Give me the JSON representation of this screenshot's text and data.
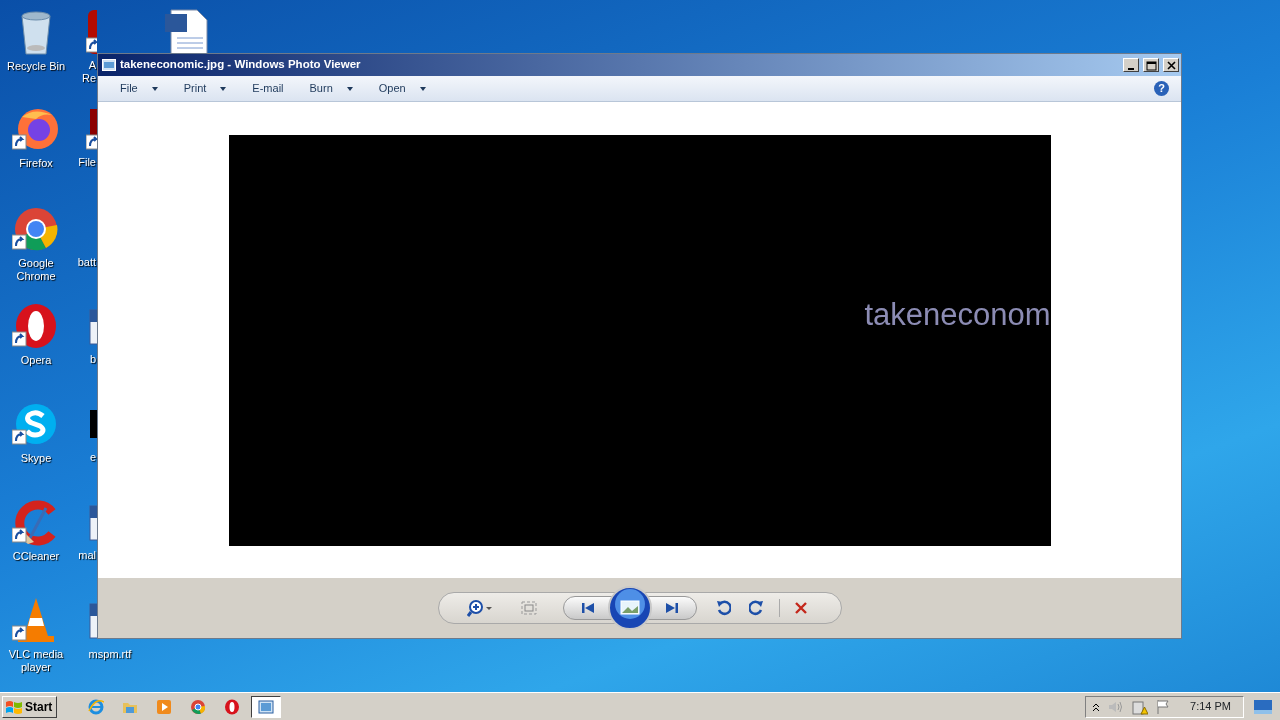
{
  "desktop_icons": [
    {
      "lines": [
        "Recycle Bin"
      ],
      "kind": "full",
      "shortcut": false
    },
    {
      "lines": [
        "Firefox"
      ],
      "kind": "full",
      "shortcut": true
    },
    {
      "lines": [
        "Google",
        "Chrome"
      ],
      "kind": "full",
      "shortcut": true
    },
    {
      "lines": [
        "Opera"
      ],
      "kind": "full",
      "shortcut": true
    },
    {
      "lines": [
        "Skype"
      ],
      "kind": "full",
      "shortcut": true
    },
    {
      "lines": [
        "CCleaner"
      ],
      "kind": "full",
      "shortcut": true
    },
    {
      "lines": [
        "VLC media",
        "player"
      ],
      "kind": "full",
      "shortcut": true
    },
    {
      "lines": [
        "A",
        "Re"
      ],
      "kind": "cut",
      "shortcut": true
    },
    {
      "lines": [
        "File"
      ],
      "kind": "cut",
      "shortcut": true
    },
    {
      "lines": [
        "batt"
      ],
      "kind": "cut",
      "shortcut": false
    },
    {
      "lines": [
        "b"
      ],
      "kind": "cut",
      "shortcut": false
    },
    {
      "lines": [
        "e"
      ],
      "kind": "cut",
      "shortcut": false
    },
    {
      "lines": [
        "mal"
      ],
      "kind": "cut",
      "shortcut": false
    },
    {
      "lines": [
        "mspm.rtf"
      ],
      "kind": "full",
      "shortcut": false
    }
  ],
  "window": {
    "title": "takeneconomic.jpg - Windows Photo Viewer",
    "menu": [
      {
        "label": "File",
        "dropdown": true
      },
      {
        "label": "Print",
        "dropdown": true
      },
      {
        "label": "E-mail",
        "dropdown": false
      },
      {
        "label": "Burn",
        "dropdown": true
      },
      {
        "label": "Open",
        "dropdown": true
      }
    ],
    "help": "?",
    "image_text": "takeneconom"
  },
  "taskbar": {
    "start": "Start",
    "apps": [
      {
        "selected": false
      },
      {
        "selected": false
      },
      {
        "selected": false
      },
      {
        "selected": false
      },
      {
        "selected": false
      },
      {
        "selected": true
      }
    ],
    "clock": "7:14 PM"
  }
}
